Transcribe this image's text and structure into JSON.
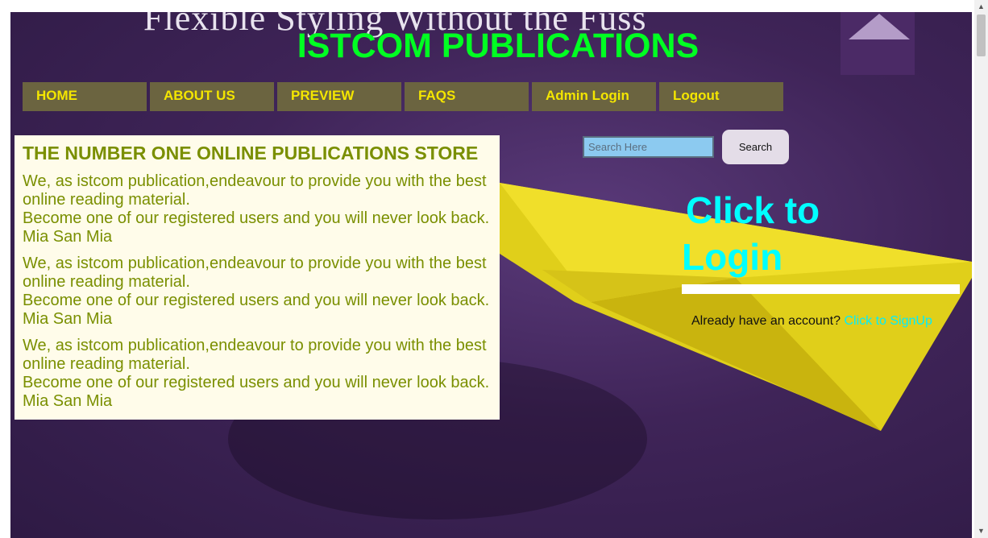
{
  "background": {
    "banner_text": "Flexible Styling Without the Fuss"
  },
  "site": {
    "title": "ISTCOM PUBLICATIONS"
  },
  "nav": {
    "items": [
      {
        "label": "HOME"
      },
      {
        "label": "ABOUT US"
      },
      {
        "label": "PREVIEW"
      },
      {
        "label": "FAQS"
      },
      {
        "label": "Admin Login"
      },
      {
        "label": "Logout"
      }
    ]
  },
  "main": {
    "heading": "THE NUMBER ONE ONLINE PUBLICATIONS STORE",
    "paragraphs": [
      {
        "line1": "We, as istcom publication,endeavour to provide you with the best online reading material.",
        "line2": "Become one of our registered users and you will never look back.",
        "line3": "Mia San Mia"
      },
      {
        "line1": "We, as istcom publication,endeavour to provide you with the best online reading material.",
        "line2": "Become one of our registered users and you will never look back.",
        "line3": "Mia San Mia"
      },
      {
        "line1": "We, as istcom publication,endeavour to provide you with the best online reading material.",
        "line2": "Become one of our registered users and you will never look back.",
        "line3": "Mia San Mia"
      }
    ]
  },
  "search": {
    "placeholder": "Search Here",
    "value": "",
    "button_label": "Search"
  },
  "login": {
    "heading_line1": "Click to",
    "heading_line2": "Login",
    "account_text": "Already have an account?",
    "signup_link": "Click to SignUp"
  },
  "colors": {
    "title": "#00ff22",
    "nav_bg": "#6b6440",
    "nav_text": "#f4e600",
    "content_text": "#7a8f00",
    "login_heading": "#00ffff",
    "search_input_bg": "#8ccaf0"
  },
  "icons": {
    "scroll_up": "scroll-up-arrow-icon",
    "scroll_down": "scroll-down-arrow-icon"
  }
}
